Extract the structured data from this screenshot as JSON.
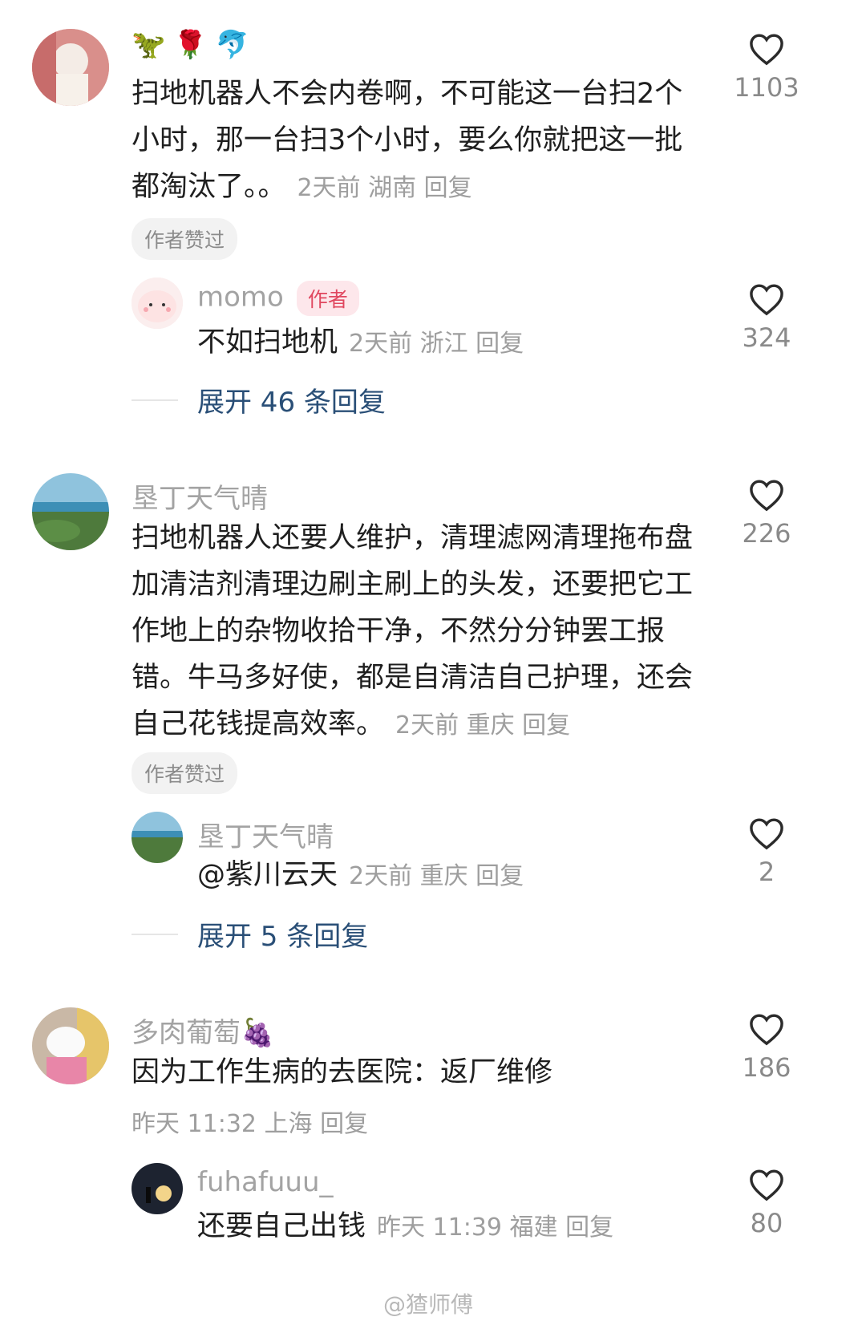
{
  "comments": [
    {
      "username_emojis": [
        "🦖",
        "🌹",
        "🐬"
      ],
      "text": "扫地机器人不会内卷啊，不可能这一台扫2个小时，那一台扫3个小时，要么你就把这一批都淘汰了。。",
      "meta": "2天前 湖南 回复",
      "author_liked": "作者赞过",
      "likes": "1103",
      "reply": {
        "username": "momo",
        "author_tag": "作者",
        "text": "不如扫地机",
        "meta": "2天前 浙江 回复",
        "likes": "324"
      },
      "expand": "展开 46 条回复"
    },
    {
      "username": "垦丁天气晴",
      "text": "扫地机器人还要人维护，清理滤网清理拖布盘加清洁剂清理边刷主刷上的头发，还要把它工作地上的杂物收拾干净，不然分分钟罢工报错。牛马多好使，都是自清洁自己护理，还会自己花钱提高效率。",
      "meta": "2天前 重庆 回复",
      "author_liked": "作者赞过",
      "likes": "226",
      "reply": {
        "username": "垦丁天气晴",
        "text": "@紫川云天",
        "meta": "2天前 重庆 回复",
        "likes": "2"
      },
      "expand": "展开 5 条回复"
    },
    {
      "username": "多肉葡萄🍇",
      "text": "因为工作生病的去医院：返厂维修",
      "meta": "昨天 11:32 上海 回复",
      "likes": "186",
      "reply": {
        "username": "fuhafuuu_",
        "text": "还要自己出钱",
        "meta": "昨天 11:39 福建 回复",
        "likes": "80"
      }
    }
  ],
  "watermark": "@猹师傅",
  "icons": {
    "like": "heart-outline-icon"
  },
  "colors": {
    "link": "#2a4f77",
    "author_tag_bg": "#fde7eb",
    "author_tag_text": "#e0475f"
  }
}
